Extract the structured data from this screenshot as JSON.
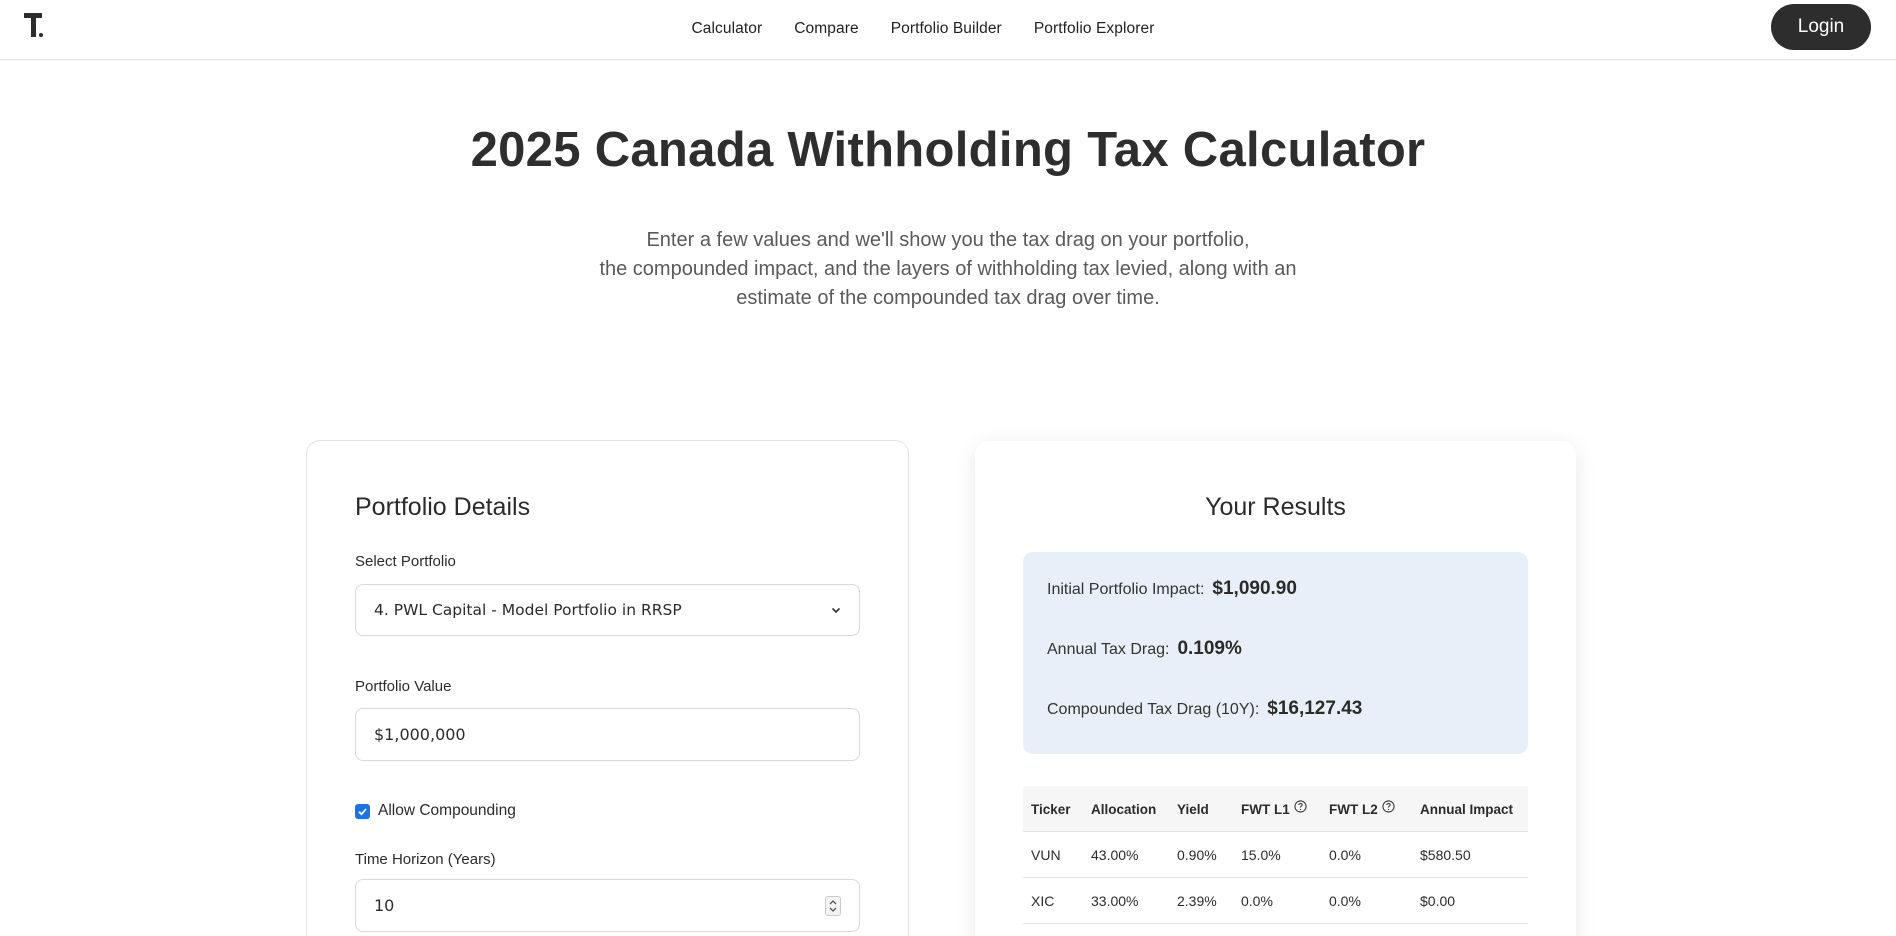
{
  "nav": {
    "logo_alt": "T.",
    "links": [
      "Calculator",
      "Compare",
      "Portfolio Builder",
      "Portfolio Explorer"
    ],
    "login_label": "Login"
  },
  "hero": {
    "title": "2025 Canada Withholding Tax Calculator",
    "subtitle_line1": "Enter a few values and we'll show you the tax drag on your portfolio,",
    "subtitle_line2": "the compounded impact, and the layers of withholding tax levied, along with an",
    "subtitle_line3": "estimate of the compounded tax drag over time."
  },
  "portfolio": {
    "title": "Portfolio Details",
    "select_label": "Select Portfolio",
    "select_value": "4. PWL Capital - Model Portfolio in RRSP",
    "value_label": "Portfolio Value",
    "value": "$1,000,000",
    "compounding_label": "Allow Compounding",
    "compounding_checked": true,
    "horizon_label": "Time Horizon (Years)",
    "horizon_value": "10"
  },
  "results": {
    "title": "Your Results",
    "initial_label": "Initial Portfolio Impact:",
    "initial_value": "$1,090.90",
    "annual_label": "Annual Tax Drag:",
    "annual_value": "0.109%",
    "compounded_label": "Compounded Tax Drag (10Y):",
    "compounded_value": "$16,127.43",
    "table": {
      "headers": [
        "Ticker",
        "Allocation",
        "Yield",
        "FWT L1",
        "FWT L2",
        "Annual Impact"
      ],
      "rows": [
        [
          "VUN",
          "43.00%",
          "0.90%",
          "15.0%",
          "0.0%",
          "$580.50"
        ],
        [
          "XIC",
          "33.00%",
          "2.39%",
          "0.0%",
          "0.0%",
          "$0.00"
        ]
      ]
    }
  },
  "colors": {
    "accent": "#1a73e8",
    "summary_bg": "#e9eff8",
    "login_bg": "#2d2d2d"
  }
}
